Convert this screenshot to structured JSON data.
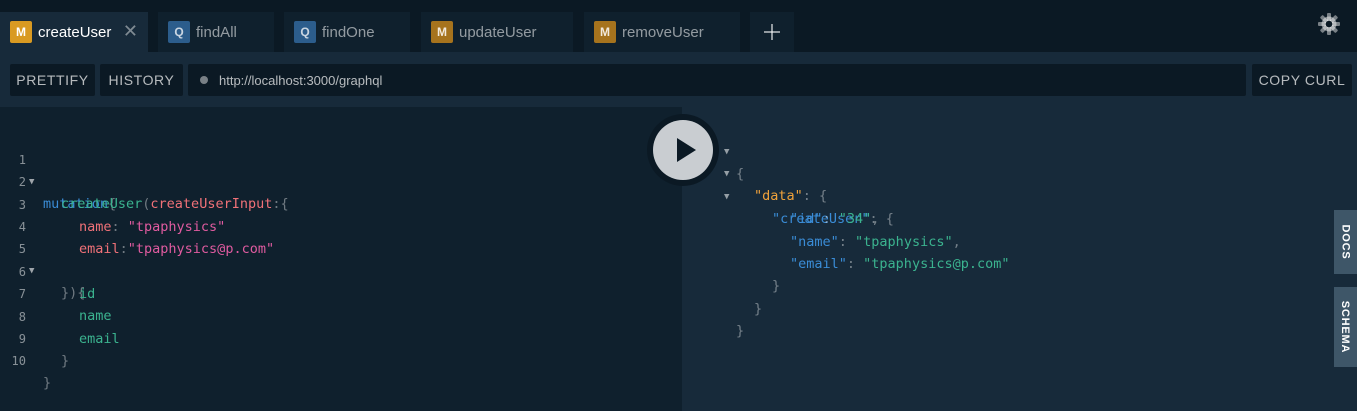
{
  "tabs": [
    {
      "badge": "M",
      "label": "createUser",
      "active": true
    },
    {
      "badge": "Q",
      "label": "findAll"
    },
    {
      "badge": "Q",
      "label": "findOne"
    },
    {
      "badge": "M",
      "label": "updateUser"
    },
    {
      "badge": "M",
      "label": "removeUser"
    }
  ],
  "tab_close": "✕",
  "toolbar": {
    "prettify_label": "PRETTIFY",
    "history_label": "HISTORY",
    "url": "http://localhost:3000/graphql",
    "copy_curl_label": "COPY CURL"
  },
  "editor": {
    "line_numbers": [
      "1",
      "2",
      "3",
      "4",
      "5",
      "6",
      "7",
      "8",
      "9",
      "10"
    ],
    "l1": {
      "kw": "mutation",
      "brace": "{"
    },
    "l2": {
      "fn": "createUser",
      "open": "(",
      "arg": "createUserInput",
      "colon": ":{"
    },
    "l3": {
      "arg": "name",
      "colon": ": ",
      "str": "\"tpaphysics\""
    },
    "l4": {
      "arg": "email",
      "colon": ":",
      "str": "\"tpaphysics@p.com\""
    },
    "l5": {
      "pun": "}){"
    },
    "l6": {
      "fld": "id"
    },
    "l7": {
      "fld": "name"
    },
    "l8": {
      "fld": "email"
    },
    "l9": {
      "pun": "}"
    },
    "l10": {
      "pun": "}"
    }
  },
  "result": {
    "r1": "{",
    "r2": {
      "key": "\"data\"",
      "rest": ": {"
    },
    "r3": {
      "key": "\"createUser\"",
      "rest": ": {"
    },
    "r4": {
      "key": "\"id\"",
      "sep": ": ",
      "val": "\"34\"",
      "end": ","
    },
    "r5": {
      "key": "\"name\"",
      "sep": ": ",
      "val": "\"tpaphysics\"",
      "end": ","
    },
    "r6": {
      "key": "\"email\"",
      "sep": ": ",
      "val": "\"tpaphysics@p.com\""
    },
    "r7": "}",
    "r8": "}",
    "r9": "}"
  },
  "side_tabs": {
    "docs": "DOCS",
    "schema": "SCHEMA"
  },
  "icons": {
    "play": "play-icon",
    "settings": "gear-icon",
    "add_tab": "plus-icon"
  },
  "colors": {
    "mutation_badge": "#d99a22",
    "query_badge": "#2c5d8c",
    "keyword": "#3a8cd6",
    "field": "#3bb38f",
    "string": "#e05ba0"
  }
}
